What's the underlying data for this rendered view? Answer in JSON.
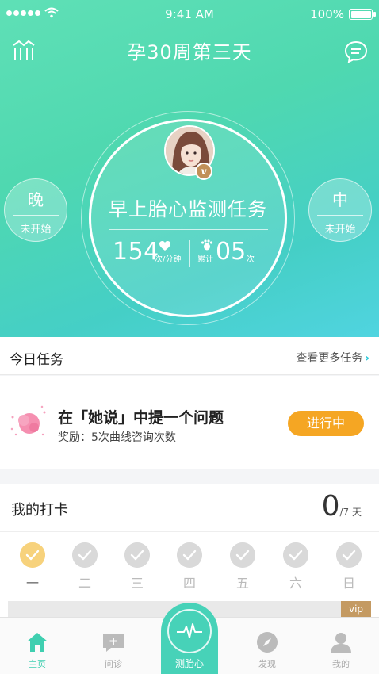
{
  "status_bar": {
    "time": "9:41 AM",
    "battery": "100%"
  },
  "header": {
    "title": "孕30周第三天",
    "left_icon": "chart-bars-icon",
    "right_icon": "chat-bubble-icon"
  },
  "monitor": {
    "task_title": "早上胎心监测任务",
    "heart_rate": "154",
    "heart_rate_unit": "次/分钟",
    "total_label": "累计",
    "total_count": "05",
    "total_unit": "次",
    "badge": "v"
  },
  "side_left": {
    "period": "晚",
    "status": "未开始"
  },
  "side_right": {
    "period": "中",
    "status": "未开始"
  },
  "today": {
    "label": "今日任务",
    "more": "查看更多任务",
    "task_question": "在「她说」中提一个问题",
    "task_reward": "奖励：5次曲线咨询次数",
    "task_status": "进行中"
  },
  "checkin": {
    "label": "我的打卡",
    "count": "0",
    "denominator": "/7 天",
    "days": [
      {
        "label": "一",
        "done": true
      },
      {
        "label": "二",
        "done": false
      },
      {
        "label": "三",
        "done": false
      },
      {
        "label": "四",
        "done": false
      },
      {
        "label": "五",
        "done": false
      },
      {
        "label": "六",
        "done": false
      },
      {
        "label": "日",
        "done": false
      }
    ]
  },
  "banner": {
    "tag": "vip"
  },
  "tabs": [
    {
      "label": "主页",
      "icon": "home-icon",
      "active": true
    },
    {
      "label": "问诊",
      "icon": "consult-icon",
      "active": false
    },
    {
      "label": "测胎心",
      "icon": "heartbeat-icon",
      "active": false
    },
    {
      "label": "发现",
      "icon": "compass-icon",
      "active": false
    },
    {
      "label": "我的",
      "icon": "profile-icon",
      "active": false
    }
  ],
  "colors": {
    "accent": "#47d2b8",
    "orange": "#f5a623",
    "checkin_done": "#f7d27c",
    "vip": "#c49a62"
  }
}
